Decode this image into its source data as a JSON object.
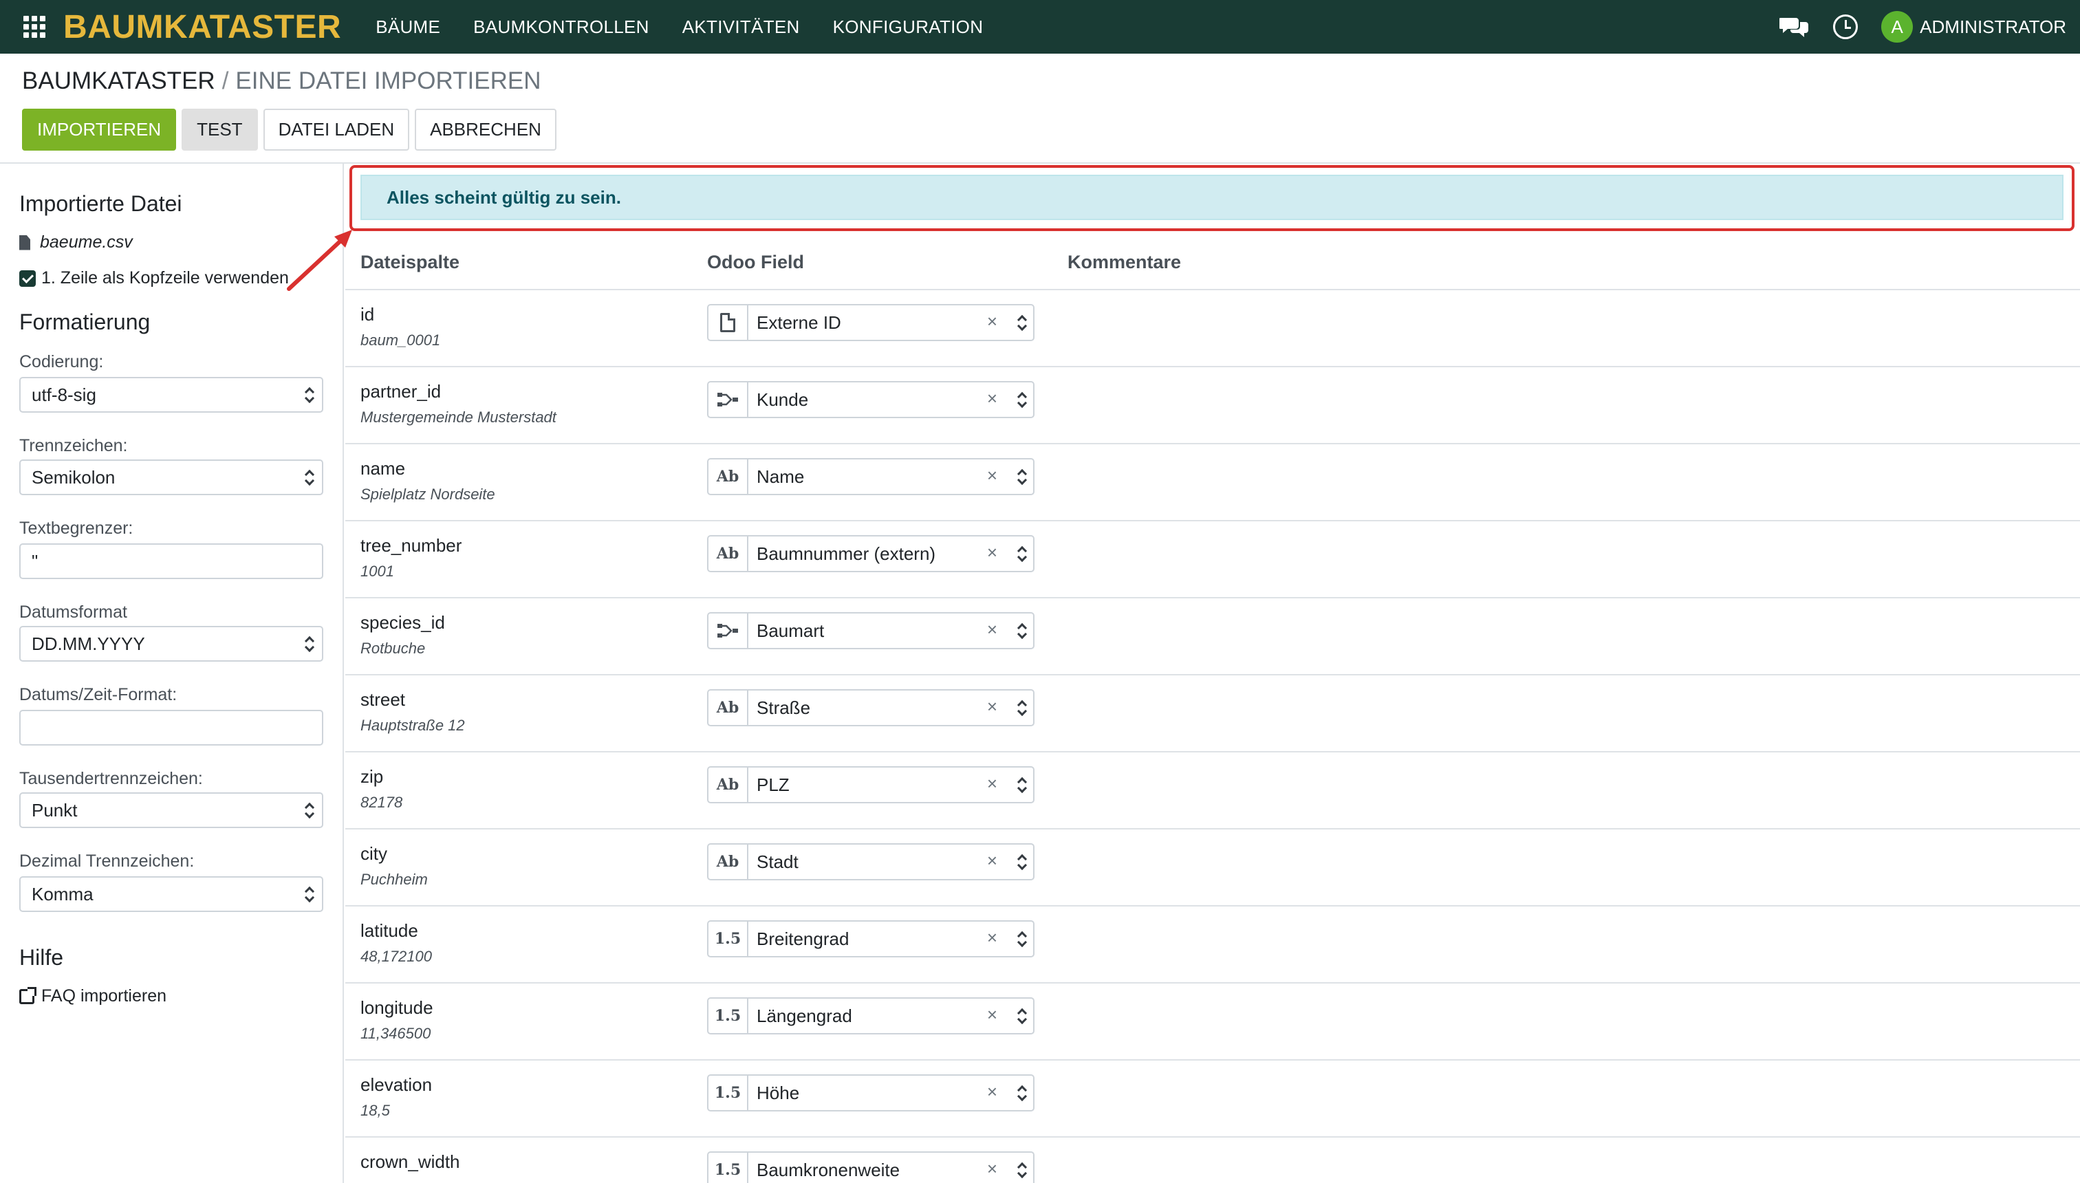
{
  "topbar": {
    "brand": "BAUMKATASTER",
    "nav": [
      "BÄUME",
      "BAUMKONTROLLEN",
      "AKTIVITÄTEN",
      "KONFIGURATION"
    ],
    "avatar_letter": "A",
    "user": "ADMINISTRATOR"
  },
  "breadcrumb": {
    "root": "BAUMKATASTER",
    "sep": "/",
    "current": "EINE DATEI IMPORTIEREN"
  },
  "buttons": {
    "import": "IMPORTIEREN",
    "test": "TEST",
    "load": "DATEI LADEN",
    "cancel": "ABBRECHEN"
  },
  "sidebar": {
    "imported_title": "Importierte Datei",
    "filename": "baeume.csv",
    "header_checkbox": "1. Zeile als Kopfzeile verwenden",
    "format_title": "Formatierung",
    "encoding_label": "Codierung:",
    "encoding": "utf-8-sig",
    "separator_label": "Trennzeichen:",
    "separator": "Semikolon",
    "quote_label": "Textbegrenzer:",
    "quote": "\"",
    "date_label": "Datumsformat",
    "date": "DD.MM.YYYY",
    "datetime_label": "Datums/Zeit-Format:",
    "datetime": "",
    "thousands_label": "Tausendertrennzeichen:",
    "thousands": "Punkt",
    "decimal_label": "Dezimal Trennzeichen:",
    "decimal": "Komma",
    "help_title": "Hilfe",
    "faq": "FAQ importieren"
  },
  "alert": "Alles scheint gültig zu sein.",
  "columns": {
    "file": "Dateispalte",
    "field": "Odoo Field",
    "comment": "Kommentare"
  },
  "rows": [
    {
      "name": "id",
      "value": "baum_0001",
      "field": "Externe ID",
      "icon": "doc"
    },
    {
      "name": "partner_id",
      "value": "Mustergemeinde Musterstadt",
      "field": "Kunde",
      "icon": "relation"
    },
    {
      "name": "name",
      "value": "Spielplatz Nordseite",
      "field": "Name",
      "icon": "Ab"
    },
    {
      "name": "tree_number",
      "value": "1001",
      "field": "Baumnummer (extern)",
      "icon": "Ab"
    },
    {
      "name": "species_id",
      "value": "Rotbuche",
      "field": "Baumart",
      "icon": "relation"
    },
    {
      "name": "street",
      "value": "Hauptstraße 12",
      "field": "Straße",
      "icon": "Ab"
    },
    {
      "name": "zip",
      "value": "82178",
      "field": "PLZ",
      "icon": "Ab"
    },
    {
      "name": "city",
      "value": "Puchheim",
      "field": "Stadt",
      "icon": "Ab"
    },
    {
      "name": "latitude",
      "value": "48,172100",
      "field": "Breitengrad",
      "icon": "1.5"
    },
    {
      "name": "longitude",
      "value": "11,346500",
      "field": "Längengrad",
      "icon": "1.5"
    },
    {
      "name": "elevation",
      "value": "18,5",
      "field": "Höhe",
      "icon": "1.5"
    },
    {
      "name": "crown_width",
      "value": "",
      "field": "Baumkronenweite",
      "icon": "1.5"
    }
  ]
}
